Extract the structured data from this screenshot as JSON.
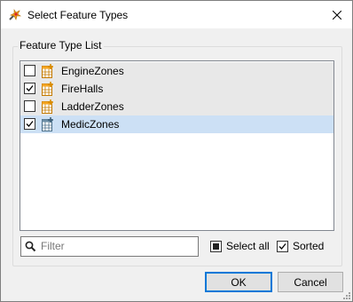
{
  "window": {
    "title": "Select Feature Types"
  },
  "group": {
    "title": "Feature Type List"
  },
  "list": {
    "items": [
      {
        "label": "EngineZones",
        "checked": false
      },
      {
        "label": "FireHalls",
        "checked": true
      },
      {
        "label": "LadderZones",
        "checked": false
      },
      {
        "label": "MedicZones",
        "checked": true
      }
    ]
  },
  "filter": {
    "placeholder": "Filter"
  },
  "options": {
    "select_all": "Select all",
    "sorted": "Sorted"
  },
  "buttons": {
    "ok": "OK",
    "cancel": "Cancel"
  },
  "colors": {
    "selection": "#cce0f5",
    "accent": "#0078d7",
    "icon": "#f5a623"
  }
}
